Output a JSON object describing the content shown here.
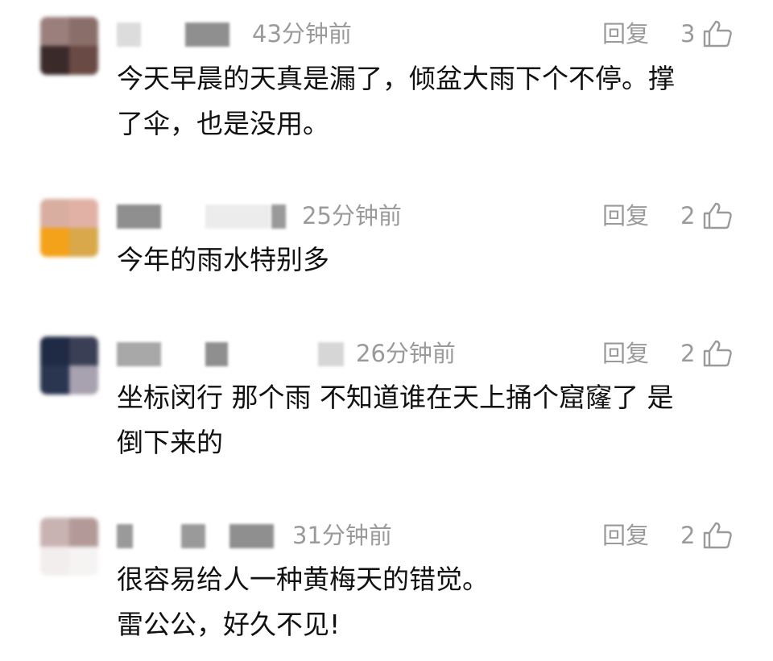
{
  "comments": [
    {
      "time": "43分钟前",
      "reply_label": "回复",
      "likes": "3",
      "text_lines": [
        "今天早晨的天真是漏了，倾盆大雨下个不停。撑",
        "了伞，也是没用。"
      ]
    },
    {
      "time": "25分钟前",
      "reply_label": "回复",
      "likes": "2",
      "text_lines": [
        "今年的雨水特别多"
      ]
    },
    {
      "time": "26分钟前",
      "reply_label": "回复",
      "likes": "2",
      "text_lines": [
        "坐标闵行 那个雨 不知道谁在天上捅个窟窿了 是",
        "倒下来的"
      ]
    },
    {
      "time": "31分钟前",
      "reply_label": "回复",
      "likes": "2",
      "text_lines": [
        "很容易给人一种黄梅天的错觉。",
        "雷公公，好久不见!"
      ]
    }
  ],
  "colors": {
    "meta_gray": "#9a9a9a",
    "text": "#111111"
  },
  "icons": {
    "like": "thumbs-up-outline-icon"
  }
}
